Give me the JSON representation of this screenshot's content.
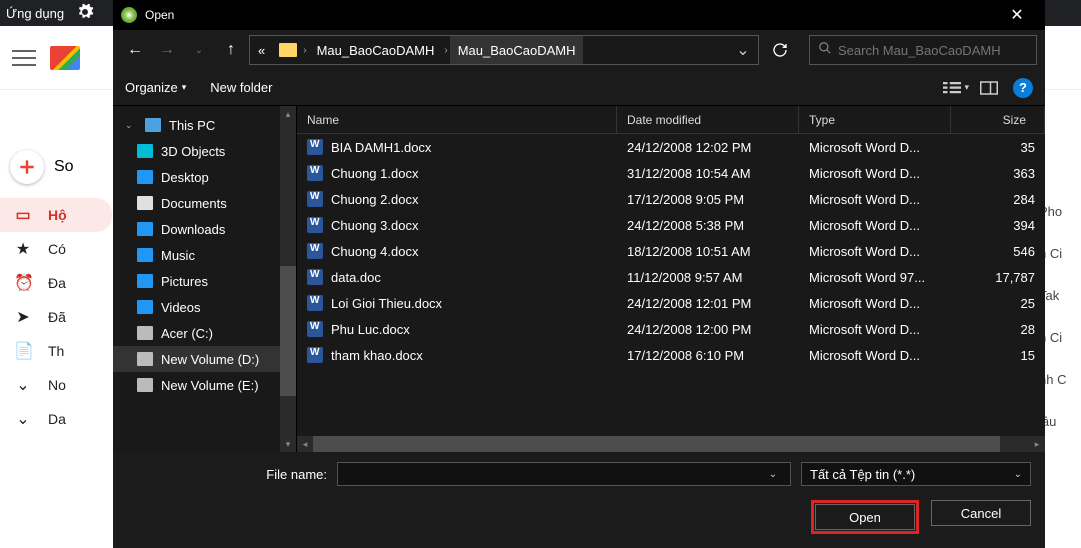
{
  "background": {
    "apps_label": "Ứng dụng",
    "compose_label": "So",
    "nav": [
      {
        "icon": "▭",
        "label": "Hộ",
        "active": true
      },
      {
        "icon": "★",
        "label": "Có",
        "active": false
      },
      {
        "icon": "⏰",
        "label": "Đa",
        "active": false
      },
      {
        "icon": "➤",
        "label": "Đã",
        "active": false
      },
      {
        "icon": "📄",
        "label": "Th",
        "active": false
      },
      {
        "icon": "⌄",
        "label": "No",
        "active": false
      },
      {
        "icon": "⌄",
        "label": "Da",
        "active": false
      }
    ],
    "right_items": [
      "Pho",
      "h Ci",
      "Tak",
      "h Ci",
      "nh C",
      "lâu"
    ]
  },
  "dialog": {
    "title": "Open",
    "breadcrumb": {
      "ellipsis": "«",
      "parts": [
        "Mau_BaoCaoDAMH",
        "Mau_BaoCaoDAMH"
      ]
    },
    "search_placeholder": "Search Mau_BaoCaoDAMH",
    "toolbar": {
      "organize": "Organize",
      "newfolder": "New folder"
    },
    "tree": [
      {
        "label": "This PC",
        "cls": "ic-pc",
        "root": true,
        "expand": "⌄"
      },
      {
        "label": "3D Objects",
        "cls": "ic-3d"
      },
      {
        "label": "Desktop",
        "cls": "ic-dt"
      },
      {
        "label": "Documents",
        "cls": "ic-doc"
      },
      {
        "label": "Downloads",
        "cls": "ic-dl"
      },
      {
        "label": "Music",
        "cls": "ic-mus"
      },
      {
        "label": "Pictures",
        "cls": "ic-pic"
      },
      {
        "label": "Videos",
        "cls": "ic-vid"
      },
      {
        "label": "Acer (C:)",
        "cls": "ic-drv"
      },
      {
        "label": "New Volume (D:)",
        "cls": "ic-drv",
        "sel": true
      },
      {
        "label": "New Volume (E:)",
        "cls": "ic-drv"
      }
    ],
    "columns": {
      "name": "Name",
      "date": "Date modified",
      "type": "Type",
      "size": "Size"
    },
    "files": [
      {
        "name": "BIA DAMH1.docx",
        "date": "24/12/2008 12:02 PM",
        "type": "Microsoft Word D...",
        "size": "35"
      },
      {
        "name": "Chuong 1.docx",
        "date": "31/12/2008 10:54 AM",
        "type": "Microsoft Word D...",
        "size": "363"
      },
      {
        "name": "Chuong 2.docx",
        "date": "17/12/2008 9:05 PM",
        "type": "Microsoft Word D...",
        "size": "284"
      },
      {
        "name": "Chuong 3.docx",
        "date": "24/12/2008 5:38 PM",
        "type": "Microsoft Word D...",
        "size": "394"
      },
      {
        "name": "Chuong 4.docx",
        "date": "18/12/2008 10:51 AM",
        "type": "Microsoft Word D...",
        "size": "546"
      },
      {
        "name": "data.doc",
        "date": "11/12/2008 9:57 AM",
        "type": "Microsoft Word 97...",
        "size": "17,787"
      },
      {
        "name": "Loi Gioi Thieu.docx",
        "date": "24/12/2008 12:01 PM",
        "type": "Microsoft Word D...",
        "size": "25"
      },
      {
        "name": "Phu Luc.docx",
        "date": "24/12/2008 12:00 PM",
        "type": "Microsoft Word D...",
        "size": "28"
      },
      {
        "name": "tham khao.docx",
        "date": "17/12/2008 6:10 PM",
        "type": "Microsoft Word D...",
        "size": "15"
      }
    ],
    "filename_label": "File name:",
    "filter_label": "Tất cả Tệp tin (*.*)",
    "open_label": "Open",
    "cancel_label": "Cancel"
  }
}
